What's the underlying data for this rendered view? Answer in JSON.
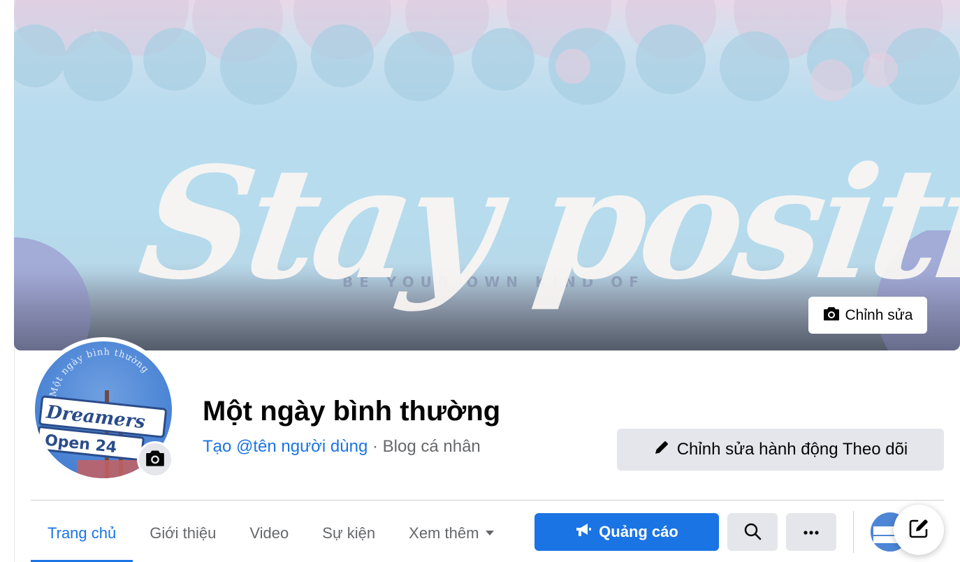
{
  "cover": {
    "script_text": "Stay positive",
    "tagline": "BE YOUR OWN KIND OF",
    "edit_button_label": "Chỉnh sửa",
    "edit_button_icon": "camera-icon"
  },
  "avatar": {
    "arc_text": "Một ngày bình thường",
    "sign_line1": "Dreamers",
    "sign_line2": "Open 24",
    "camera_icon": "camera-icon"
  },
  "page": {
    "name": "Một ngày bình thường",
    "username_link": "Tạo @tên người dùng",
    "separator": "·",
    "category": "Blog cá nhân"
  },
  "actions": {
    "follow_edit_label": "Chỉnh sửa hành động Theo dõi",
    "follow_edit_icon": "pencil-icon",
    "ads_label": "Quảng cáo",
    "ads_icon": "megaphone-icon",
    "search_icon": "search-icon",
    "more_icon": "more-icon",
    "compose_icon": "compose-icon"
  },
  "tabs": [
    {
      "label": "Trang chủ",
      "active": true
    },
    {
      "label": "Giới thiệu",
      "active": false
    },
    {
      "label": "Video",
      "active": false
    },
    {
      "label": "Sự kiện",
      "active": false
    },
    {
      "label": "Xem thêm",
      "active": false
    }
  ],
  "colors": {
    "accent": "#1b74e4",
    "button_gray": "#e4e6eb",
    "text_secondary": "#65676b"
  }
}
